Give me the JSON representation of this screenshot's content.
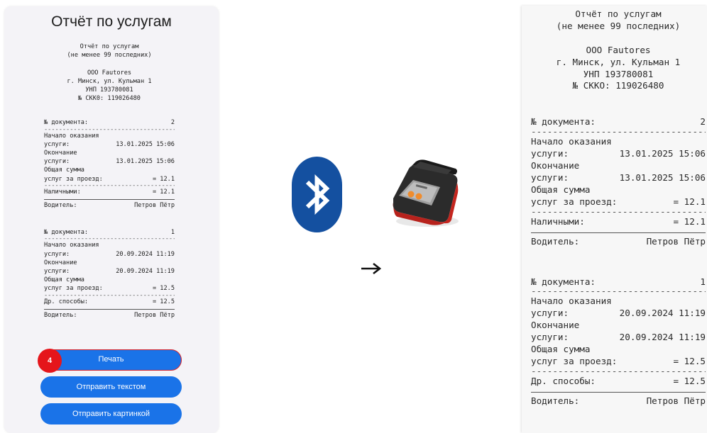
{
  "phone": {
    "title": "Отчёт по услугам",
    "receipt": {
      "header": [
        "Отчёт по услугам",
        "(не менее 99 последних)",
        "",
        "ООО Fautores",
        "г. Минск, ул. Кульман 1",
        "УНП 193780081",
        "№ СКК0: 119026480"
      ],
      "documents": [
        {
          "doc_label": "№ документа:",
          "doc_number": "2",
          "start_label_1": "Начало оказания",
          "start_label_2": "услуги:",
          "start_value": "13.01.2025 15:06",
          "end_label_1": "Окончание",
          "end_label_2": "услуги:",
          "end_value": "13.01.2025 15:06",
          "sum_label_1": "Общая сумма",
          "sum_label_2": "услуг за проезд:",
          "sum_value": "= 12.1",
          "pay_label": "Наличными:",
          "pay_value": "= 12.1",
          "driver_label": "Водитель:",
          "driver_value": "Петров Пётр"
        },
        {
          "doc_label": "№ документа:",
          "doc_number": "1",
          "start_label_1": "Начало оказания",
          "start_label_2": "услуги:",
          "start_value": "20.09.2024 11:19",
          "end_label_1": "Окончание",
          "end_label_2": "услуги:",
          "end_value": "20.09.2024 11:19",
          "sum_label_1": "Общая сумма",
          "sum_label_2": "услуг за проезд:",
          "sum_value": "= 12.5",
          "pay_label": "Др. способы:",
          "pay_value": "= 12.5",
          "driver_label": "Водитель:",
          "driver_value": "Петров Пётр"
        }
      ]
    },
    "buttons": {
      "print": "Печать",
      "send_text": "Отправить текстом",
      "send_image": "Отправить картинкой"
    },
    "badge": "4"
  },
  "icons": {
    "bluetooth": "bluetooth-icon",
    "printer": "thermal-printer-icon",
    "arrow": "arrow-right-icon"
  },
  "colors": {
    "button_blue": "#1a73e8",
    "badge_red": "#e5151b",
    "bluetooth_blue": "#1450a0"
  },
  "printed": {
    "header": [
      "Отчёт по услугам",
      "(не менее 99 последних)",
      "",
      "ООО Fautores",
      "г. Минск, ул. Кульман 1",
      "УНП 193780081",
      "№ СККО: 119026480"
    ],
    "documents": [
      {
        "doc_label": "№ документа:",
        "doc_number": "2",
        "start_label_1": "Начало оказания",
        "start_label_2": "услуги:",
        "start_value": "13.01.2025 15:06",
        "end_label_1": "Окончание",
        "end_label_2": "услуги:",
        "end_value": "13.01.2025 15:06",
        "sum_label_1": "Общая сумма",
        "sum_label_2": "услуг за проезд:",
        "sum_value": "= 12.1",
        "pay_label": "Наличными:",
        "pay_value": "= 12.1",
        "driver_label": "Водитель:",
        "driver_value": "Петров Пётр"
      },
      {
        "doc_label": "№ документа:",
        "doc_number": "1",
        "start_label_1": "Начало оказания",
        "start_label_2": "услуги:",
        "start_value": "20.09.2024 11:19",
        "end_label_1": "Окончание",
        "end_label_2": "услуги:",
        "end_value": "20.09.2024 11:19",
        "sum_label_1": "Общая сумма",
        "sum_label_2": "услуг за проезд:",
        "sum_value": "= 12.5",
        "pay_label": "Др. способы:",
        "pay_value": "= 12.5",
        "driver_label": "Водитель:",
        "driver_value": "Петров Пётр"
      }
    ]
  }
}
